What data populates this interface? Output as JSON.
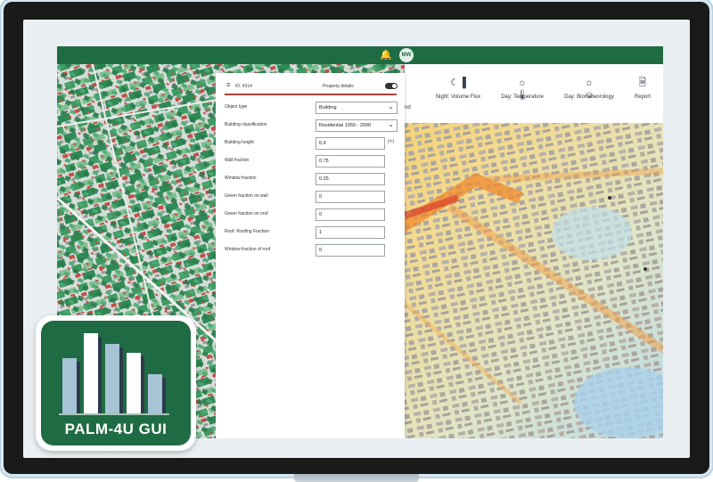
{
  "header": {
    "bell_icon": "bell-icon",
    "avatar_initials": "MW"
  },
  "toolbar": {
    "partial_label": "nd",
    "items": [
      {
        "label": "Night: Volume Flux",
        "icon": "moon-bars-icon"
      },
      {
        "label": "Day: Temperature",
        "icon": "sun-thermometer-icon"
      },
      {
        "label": "Day: Biometeorology",
        "icon": "sun-person-icon"
      },
      {
        "label": "Report",
        "icon": "document-icon"
      }
    ]
  },
  "panel": {
    "object_id": "ID: 4314",
    "details_label": "Property details",
    "details_toggle_on": true,
    "fields": [
      {
        "label": "Object type",
        "value": "Building",
        "kind": "select"
      },
      {
        "label": "Building classification",
        "value": "Residential 1950 - 2000",
        "kind": "select"
      },
      {
        "label": "Building height",
        "value": "6.9",
        "kind": "input",
        "unit": "[m]"
      },
      {
        "label": "Wall fraction",
        "value": "0.75",
        "kind": "input"
      },
      {
        "label": "Window fraction",
        "value": "0.25",
        "kind": "input"
      },
      {
        "label": "Green fraction on wall",
        "value": "0",
        "kind": "input"
      },
      {
        "label": "Green fraction on roof",
        "value": "0",
        "kind": "input"
      },
      {
        "label": "Roof: Roofing Fraction",
        "value": "1",
        "kind": "input"
      },
      {
        "label": "Window fraction of roof",
        "value": "0",
        "kind": "input"
      }
    ]
  },
  "logo": {
    "text": "PALM-4U GUI"
  },
  "colors": {
    "brand_green": "#1f6b43",
    "accent_red": "#b3403c"
  }
}
